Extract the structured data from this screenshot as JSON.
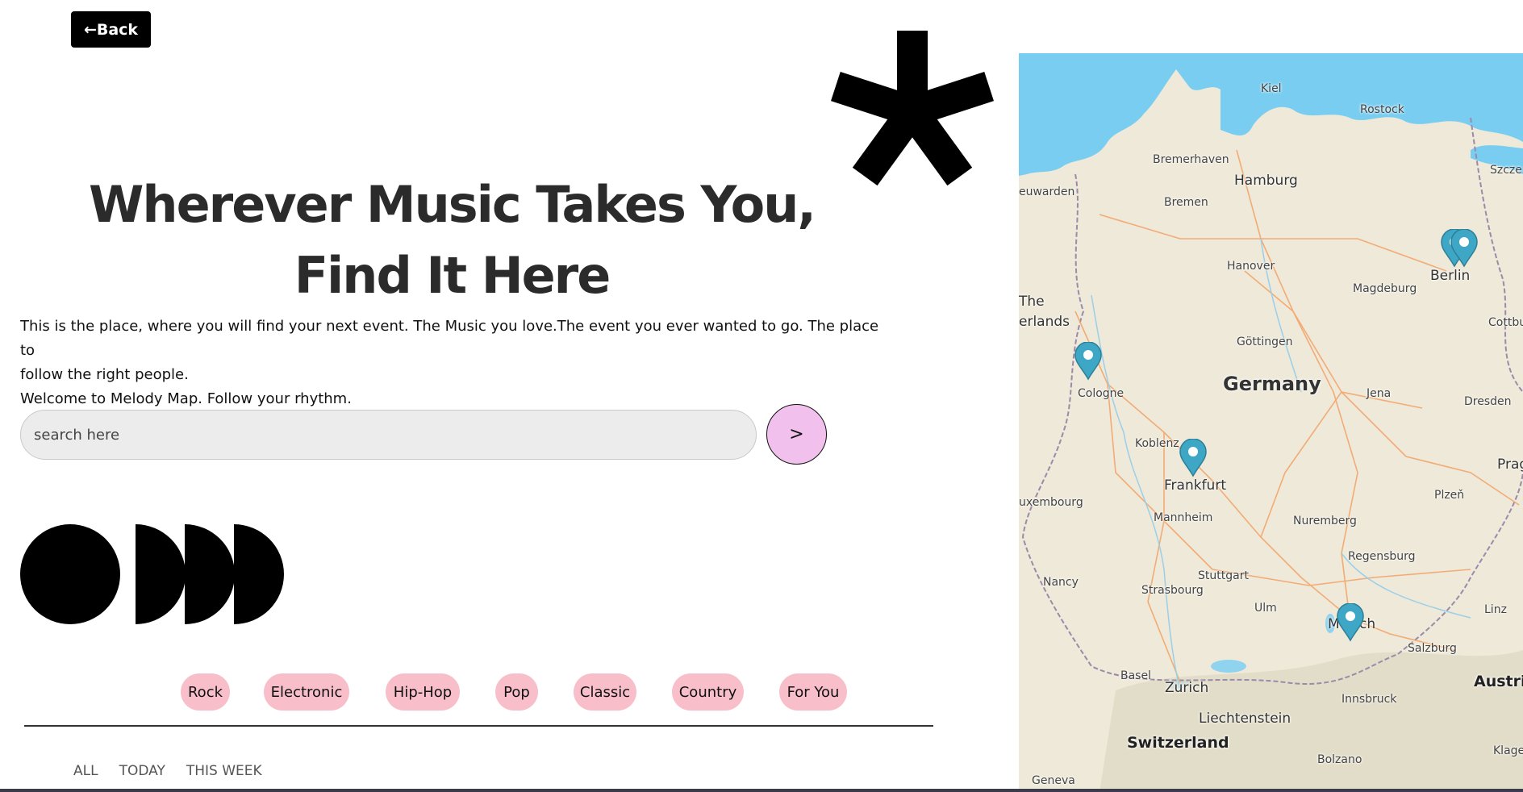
{
  "nav": {
    "back_label": "←Back"
  },
  "hero": {
    "title_line1": "Wherever Music Takes You,",
    "title_line2": "Find It Here"
  },
  "intro": {
    "line1": "This is the place, where you will find your next event. The Music you love.The event you ever wanted to go. The place to",
    "line2": "follow the right people.",
    "line3": "Welcome to Melody Map. Follow your rhythm."
  },
  "search": {
    "placeholder": "search here",
    "submit_label": ">"
  },
  "genres": [
    "Rock",
    "Electronic",
    "Hip-Hop",
    "Pop",
    "Classic",
    "Country",
    "For You"
  ],
  "filters": [
    "ALL",
    "TODAY",
    "THIS WEEK"
  ],
  "colors": {
    "accent_pink": "#f2c0ec",
    "genre_pill": "#f8bfcb",
    "water": "#78cdf0",
    "land": "#eee9d8",
    "pin": "#3fa7c6"
  },
  "map": {
    "country_label": "Germany",
    "labels": {
      "kiel": "Kiel",
      "rostock": "Rostock",
      "bremerhaven": "Bremerhaven",
      "hamburg": "Hamburg",
      "szczecin": "Szcze",
      "leeuwarden": "euwarden",
      "bremen": "Bremen",
      "berlin": "Berlin",
      "hanover": "Hanover",
      "magdeburg": "Magdeburg",
      "the": "The",
      "netherlands": "erlands",
      "cottbus": "Cottbus",
      "gottingen": "Göttingen",
      "cologne": "Cologne",
      "jena": "Jena",
      "dresden": "Dresden",
      "koblenz": "Koblenz",
      "frankfurt": "Frankfurt",
      "prague": "Pragu",
      "luxembourg": "uxembourg",
      "plzen": "Plzeň",
      "mannheim": "Mannheim",
      "nuremberg": "Nuremberg",
      "regensburg": "Regensburg",
      "stuttgart": "Stuttgart",
      "nancy": "Nancy",
      "strasbourg": "Strasbourg",
      "ulm": "Ulm",
      "munich_left": "M",
      "munich_right": "ch",
      "linz": "Linz",
      "salzburg": "Salzburg",
      "austria": "Austria",
      "basel": "Basel",
      "zurich": "Zurich",
      "innsbruck": "Innsbruck",
      "liechtenstein": "Liechtenstein",
      "switzerland": "Switzerland",
      "klagenfurt": "Klagenfur",
      "bolzano": "Bolzano",
      "geneva": "Geneva"
    }
  }
}
